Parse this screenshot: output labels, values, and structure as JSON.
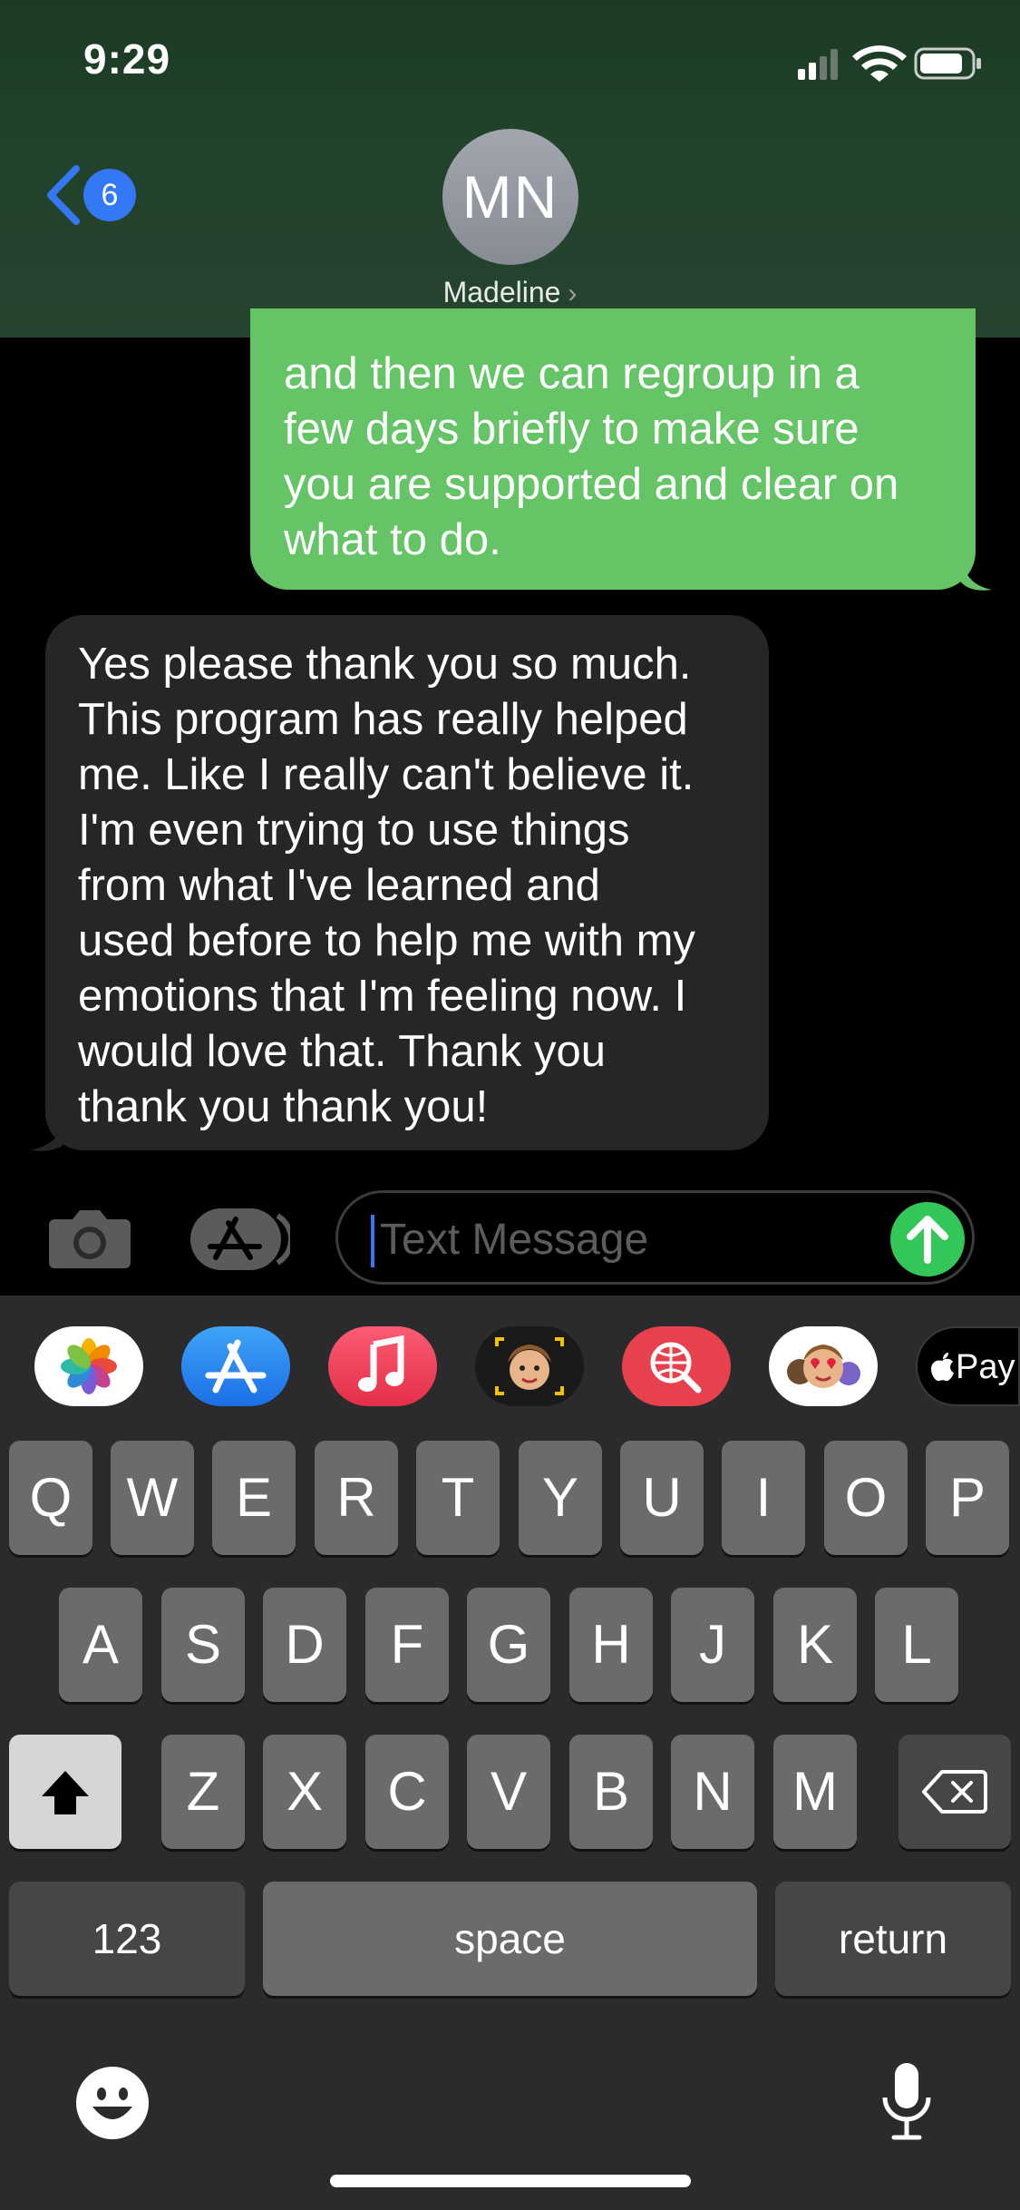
{
  "status_bar": {
    "time": "9:29"
  },
  "header": {
    "back_count": "6",
    "avatar_initials": "MN",
    "contact_name": "Madeline"
  },
  "messages": {
    "outgoing": "and then we can regroup in a\nfew days briefly to make sure\nyou are supported and clear on\nwhat to do.",
    "incoming": "Yes please thank you so much.\nThis program has really helped\nme. Like I really can't believe it.\nI'm even trying to use things\nfrom what I've learned and\nused before to help me with my\nemotions that I'm feeling now. I\nwould love that. Thank you\nthank you thank you!"
  },
  "composer": {
    "placeholder": "Text Message"
  },
  "apps": {
    "apple_pay_label": "Pay"
  },
  "keyboard": {
    "row1": [
      "Q",
      "W",
      "E",
      "R",
      "T",
      "Y",
      "U",
      "I",
      "O",
      "P"
    ],
    "row2": [
      "A",
      "S",
      "D",
      "F",
      "G",
      "H",
      "J",
      "K",
      "L"
    ],
    "row3": [
      "Z",
      "X",
      "C",
      "V",
      "B",
      "N",
      "M"
    ],
    "numbers_label": "123",
    "space_label": "space",
    "return_label": "return"
  },
  "colors": {
    "outgoing_bubble": "#65c466",
    "incoming_bubble": "#262628",
    "accent": "#3478f6",
    "send": "#33c659"
  }
}
